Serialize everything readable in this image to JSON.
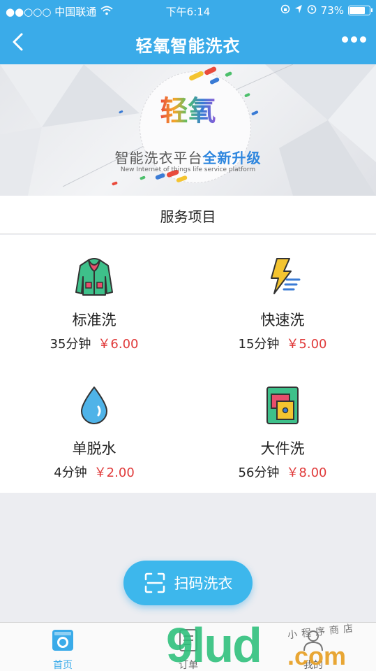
{
  "status_bar": {
    "carrier": "●●○○○ 中国联通",
    "time": "下午6:14",
    "battery": "73%",
    "battery_level": 0.73
  },
  "nav": {
    "title": "轻氧智能洗衣"
  },
  "banner": {
    "brand": "轻氧",
    "headline_plain": "智能洗衣平台",
    "headline_highlight": "全新升级",
    "subline": "New Internet of things life service platform"
  },
  "section": {
    "title": "服务项目"
  },
  "services": [
    {
      "name": "标准洗",
      "duration": "35分钟",
      "price": "￥6.00",
      "icon": "jacket-icon"
    },
    {
      "name": "快速洗",
      "duration": "15分钟",
      "price": "￥5.00",
      "icon": "lightning-icon"
    },
    {
      "name": "单脱水",
      "duration": "4分钟",
      "price": "￥2.00",
      "icon": "water-drop-icon"
    },
    {
      "name": "大件洗",
      "duration": "56分钟",
      "price": "￥8.00",
      "icon": "bedding-icon"
    }
  ],
  "scan_button": {
    "label": "扫码洗衣"
  },
  "tabs": [
    {
      "label": "首页",
      "icon": "washing-machine-icon",
      "active": true
    },
    {
      "label": "订单",
      "icon": "order-icon",
      "active": false
    },
    {
      "label": "我的",
      "icon": "profile-icon",
      "active": false
    }
  ],
  "watermark": {
    "main": "9lud",
    "suffix": ".com",
    "script": "小程序商店"
  },
  "colors": {
    "primary": "#3aabe9",
    "price": "#e03a3a",
    "background": "#ecedf1"
  }
}
